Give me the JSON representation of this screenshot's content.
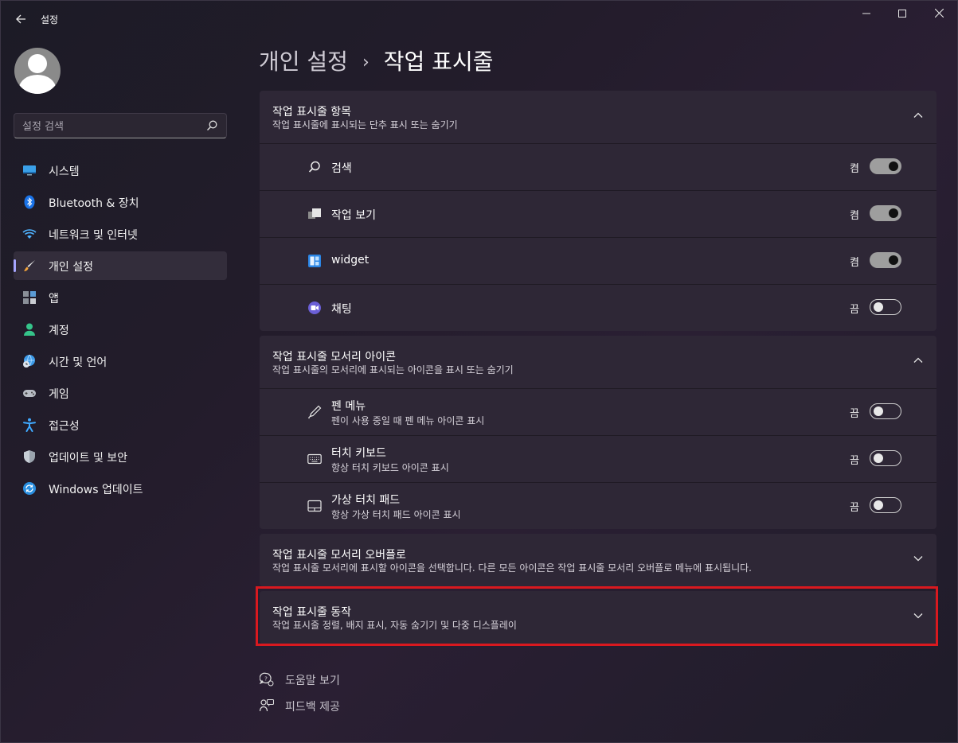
{
  "app": {
    "title": "설정"
  },
  "window_controls": {
    "minimize": "—",
    "maximize": "☐",
    "close": "✕"
  },
  "search": {
    "placeholder": "설정 검색"
  },
  "sidebar": {
    "items": [
      {
        "label": "시스템",
        "icon": "monitor-icon",
        "active": false
      },
      {
        "label": "Bluetooth & 장치",
        "icon": "bluetooth-icon",
        "active": false
      },
      {
        "label": "네트워크 및 인터넷",
        "icon": "wifi-icon",
        "active": false
      },
      {
        "label": "개인 설정",
        "icon": "brush-icon",
        "active": true
      },
      {
        "label": "앱",
        "icon": "apps-icon",
        "active": false
      },
      {
        "label": "계정",
        "icon": "person-icon",
        "active": false
      },
      {
        "label": "시간 및 언어",
        "icon": "globe-clock-icon",
        "active": false
      },
      {
        "label": "게임",
        "icon": "gamepad-icon",
        "active": false
      },
      {
        "label": "접근성",
        "icon": "accessibility-icon",
        "active": false
      },
      {
        "label": "업데이트 및 보안",
        "icon": "shield-icon",
        "active": false
      },
      {
        "label": "Windows 업데이트",
        "icon": "update-icon",
        "active": false
      }
    ]
  },
  "breadcrumb": {
    "parent": "개인 설정",
    "separator": "›",
    "current": "작업 표시줄"
  },
  "sections": {
    "taskbar_items": {
      "title": "작업 표시줄 항목",
      "desc": "작업 표시줄에 표시되는 단추 표시 또는 숨기기",
      "rows": [
        {
          "label": "검색",
          "state": "켬",
          "on": true,
          "icon": "search-icon"
        },
        {
          "label": "작업 보기",
          "state": "켬",
          "on": true,
          "icon": "task-view-icon"
        },
        {
          "label": "widget",
          "state": "켬",
          "on": true,
          "icon": "widgets-icon"
        },
        {
          "label": "채팅",
          "state": "끔",
          "on": false,
          "icon": "chat-icon"
        }
      ]
    },
    "corner_icons": {
      "title": "작업 표시줄 모서리 아이콘",
      "desc": "작업 표시줄의 모서리에 표시되는 아이콘을 표시 또는 숨기기",
      "rows": [
        {
          "label": "펜 메뉴",
          "sub": "펜이 사용 중일 때 펜 메뉴 아이콘 표시",
          "state": "끔",
          "on": false,
          "icon": "pen-icon"
        },
        {
          "label": "터치 키보드",
          "sub": "항상 터치 키보드 아이콘 표시",
          "state": "끔",
          "on": false,
          "icon": "keyboard-icon"
        },
        {
          "label": "가상 터치 패드",
          "sub": "항상 가상 터치 패드 아이콘 표시",
          "state": "끔",
          "on": false,
          "icon": "touchpad-icon"
        }
      ]
    },
    "overflow": {
      "title": "작업 표시줄 모서리 오버플로",
      "desc": "작업 표시줄 모서리에 표시할 아이콘을 선택합니다. 다른 모든 아이콘은 작업 표시줄 모서리 오버플로 메뉴에 표시됩니다."
    },
    "behaviors": {
      "title": "작업 표시줄 동작",
      "desc": "작업 표시줄 정렬, 배지 표시, 자동 숨기기 및 다중 디스플레이"
    }
  },
  "help": {
    "get_help": "도움말 보기",
    "feedback": "피드백 제공"
  },
  "colors": {
    "accent": "#a6a6ff",
    "highlight_border": "#d9191f"
  }
}
